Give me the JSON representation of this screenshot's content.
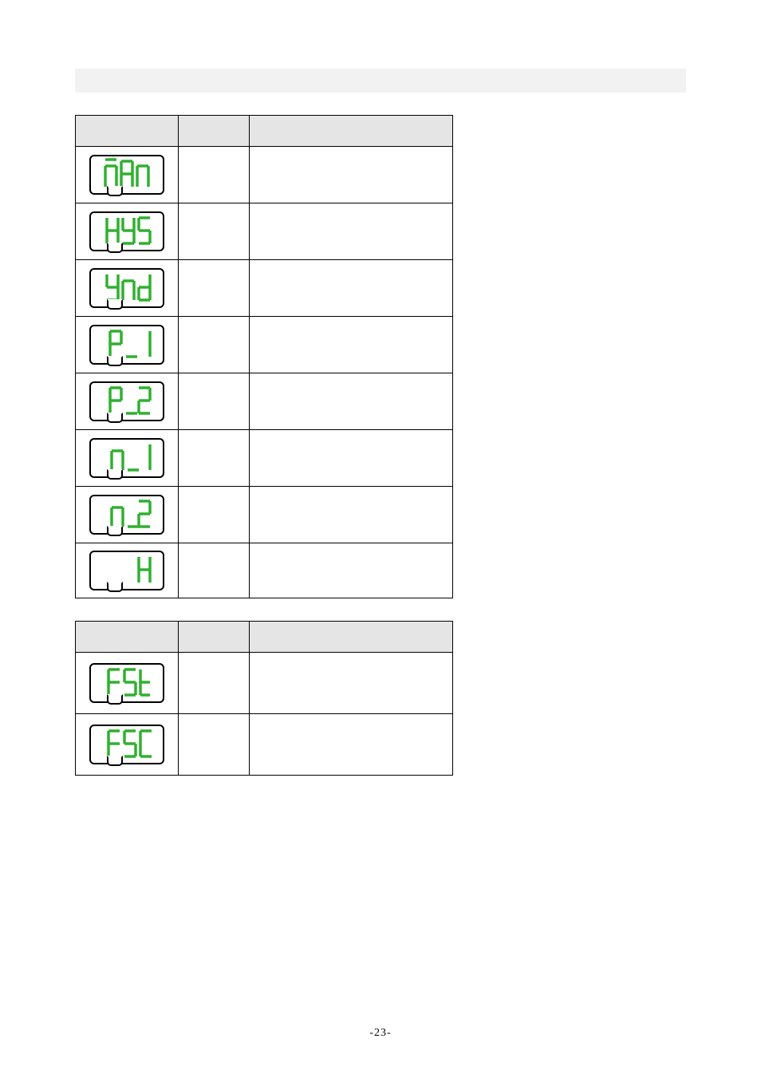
{
  "page_number": "-23-",
  "tables": [
    {
      "headers": [
        "",
        "",
        ""
      ],
      "rows": [
        {
          "display_code": "mAn",
          "name": "",
          "desc": ""
        },
        {
          "display_code": "HYS",
          "name": "",
          "desc": ""
        },
        {
          "display_code": "Ynd",
          "name": "",
          "desc": ""
        },
        {
          "display_code": "P_1",
          "name": "",
          "desc": ""
        },
        {
          "display_code": "P_2",
          "name": "",
          "desc": ""
        },
        {
          "display_code": "n_1",
          "name": "",
          "desc": ""
        },
        {
          "display_code": "n_2",
          "name": "",
          "desc": ""
        },
        {
          "display_code": "H",
          "name": "",
          "desc": ""
        }
      ]
    },
    {
      "headers": [
        "",
        "",
        ""
      ],
      "rows": [
        {
          "display_code": "FSt",
          "name": "",
          "desc": ""
        },
        {
          "display_code": "FSC",
          "name": "",
          "desc": ""
        }
      ]
    }
  ]
}
